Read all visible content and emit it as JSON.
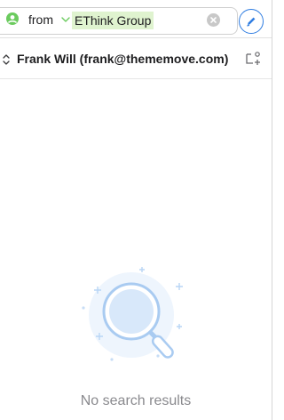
{
  "search": {
    "token_label": "from",
    "value": "EThink Group"
  },
  "account": {
    "label": "Frank Will (frank@thememove.com)"
  },
  "empty_state": {
    "message": "No search results"
  },
  "colors": {
    "accent": "#2f7de1",
    "token_highlight": "#dff3cf",
    "person_icon": "#6bcb5e"
  },
  "icons": [
    "person-icon",
    "chevron-down-icon",
    "clear-icon",
    "compose-icon",
    "updown-icon",
    "add-folder-icon",
    "magnifier-icon"
  ]
}
